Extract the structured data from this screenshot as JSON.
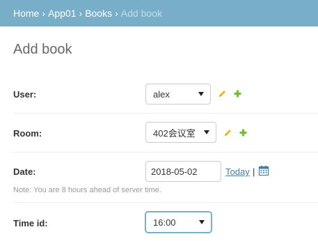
{
  "breadcrumbs": {
    "home": "Home",
    "app": "App01",
    "model": "Books",
    "current": "Add book",
    "separator": "›"
  },
  "page": {
    "title": "Add book"
  },
  "form": {
    "user": {
      "label": "User:",
      "value": "alex"
    },
    "room": {
      "label": "Room:",
      "value": "402会议室"
    },
    "date": {
      "label": "Date:",
      "value": "2018-05-02",
      "today_link": "Today",
      "separator": "|",
      "note": "Note: You are 8 hours ahead of server time."
    },
    "time_id": {
      "label": "Time id:",
      "value": "16:00"
    }
  },
  "colors": {
    "header_bg": "#79aec8",
    "link": "#447e9b",
    "edit_icon": "#efb80b",
    "add_icon": "#70bf2b"
  },
  "icons": {
    "edit": "pencil-icon",
    "add": "plus-icon",
    "calendar": "calendar-icon"
  }
}
